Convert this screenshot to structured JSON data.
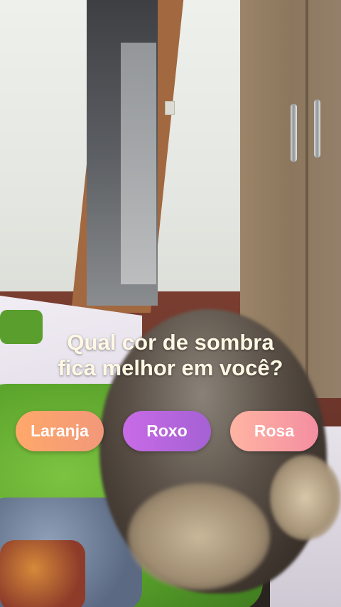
{
  "quiz": {
    "question_line1": "Qual cor de sombra",
    "question_line2": "fica melhor em você?",
    "options": [
      {
        "label": "Laranja",
        "color": "#f8a070"
      },
      {
        "label": "Roxo",
        "color": "#b565dd"
      },
      {
        "label": "Rosa",
        "color": "#f7a0a3"
      }
    ]
  }
}
